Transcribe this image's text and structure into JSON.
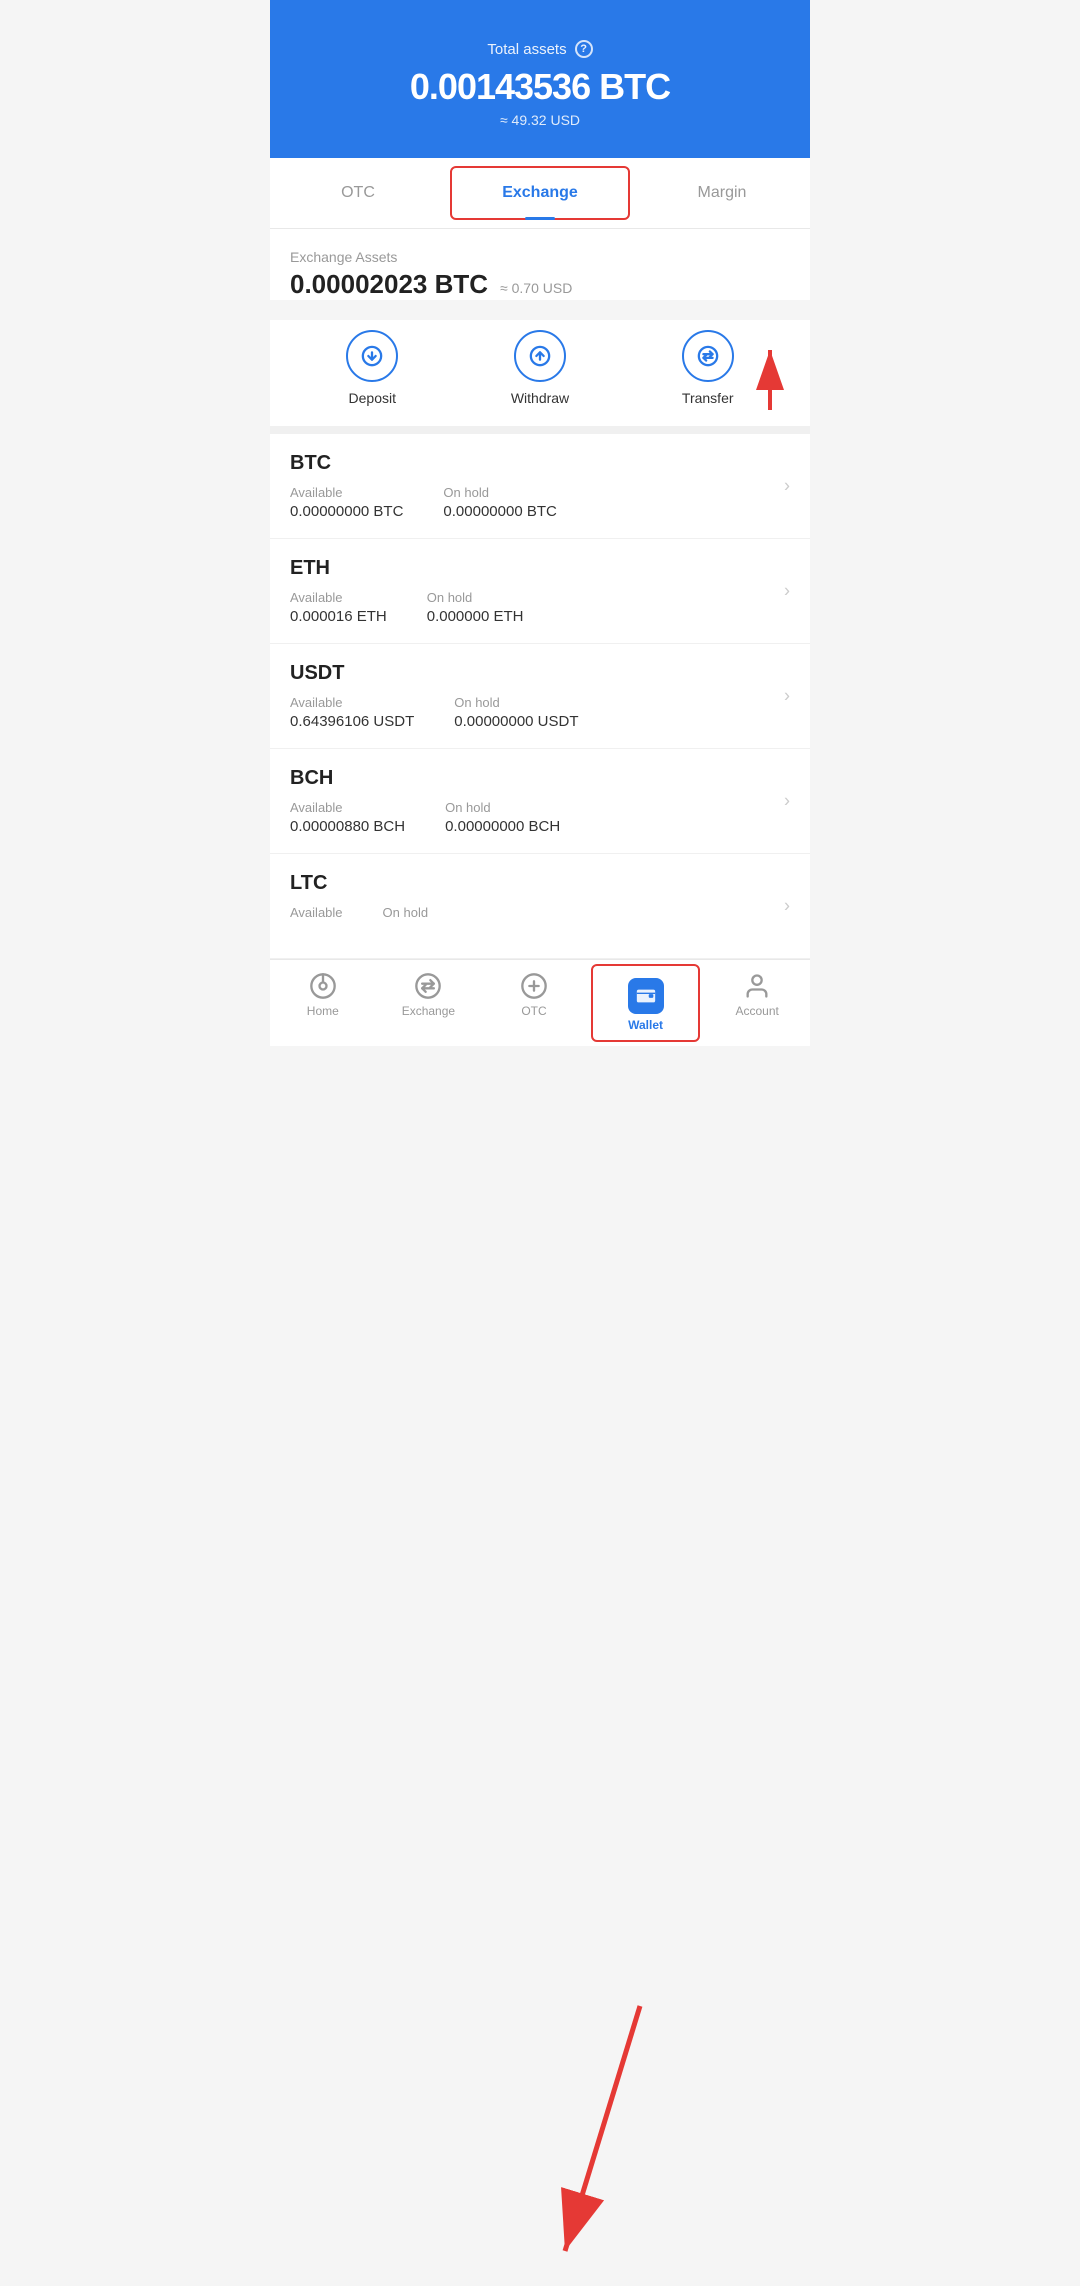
{
  "header": {
    "title": "Total assets",
    "help_icon": "?",
    "amount": "0.00143536 BTC",
    "usd": "≈ 49.32 USD"
  },
  "tabs": [
    {
      "id": "otc",
      "label": "OTC",
      "active": false
    },
    {
      "id": "exchange",
      "label": "Exchange",
      "active": true
    },
    {
      "id": "margin",
      "label": "Margin",
      "active": false
    }
  ],
  "exchange": {
    "label": "Exchange Assets",
    "amount": "0.00002023 BTC",
    "usd": "≈ 0.70 USD"
  },
  "actions": [
    {
      "id": "deposit",
      "label": "Deposit",
      "icon": "down"
    },
    {
      "id": "withdraw",
      "label": "Withdraw",
      "icon": "up"
    },
    {
      "id": "transfer",
      "label": "Transfer",
      "icon": "transfer"
    }
  ],
  "assets": [
    {
      "symbol": "BTC",
      "available_label": "Available",
      "available": "0.00000000 BTC",
      "onhold_label": "On hold",
      "onhold": "0.00000000 BTC"
    },
    {
      "symbol": "ETH",
      "available_label": "Available",
      "available": "0.000016 ETH",
      "onhold_label": "On hold",
      "onhold": "0.000000 ETH"
    },
    {
      "symbol": "USDT",
      "available_label": "Available",
      "available": "0.64396106 USDT",
      "onhold_label": "On hold",
      "onhold": "0.00000000 USDT"
    },
    {
      "symbol": "BCH",
      "available_label": "Available",
      "available": "0.00000880 BCH",
      "onhold_label": "On hold",
      "onhold": "0.00000000 BCH"
    },
    {
      "symbol": "LTC",
      "available_label": "Available",
      "available": "",
      "onhold_label": "On hold",
      "onhold": ""
    }
  ],
  "bottom_nav": [
    {
      "id": "home",
      "label": "Home",
      "icon": "home",
      "active": false
    },
    {
      "id": "exchange",
      "label": "Exchange",
      "icon": "exchange",
      "active": false
    },
    {
      "id": "otc",
      "label": "OTC",
      "icon": "otc",
      "active": false
    },
    {
      "id": "wallet",
      "label": "Wallet",
      "icon": "wallet",
      "active": true
    },
    {
      "id": "account",
      "label": "Account",
      "icon": "account",
      "active": false
    }
  ],
  "colors": {
    "primary": "#2979e8",
    "red_accent": "#e53935",
    "text_dark": "#222222",
    "text_gray": "#999999"
  }
}
